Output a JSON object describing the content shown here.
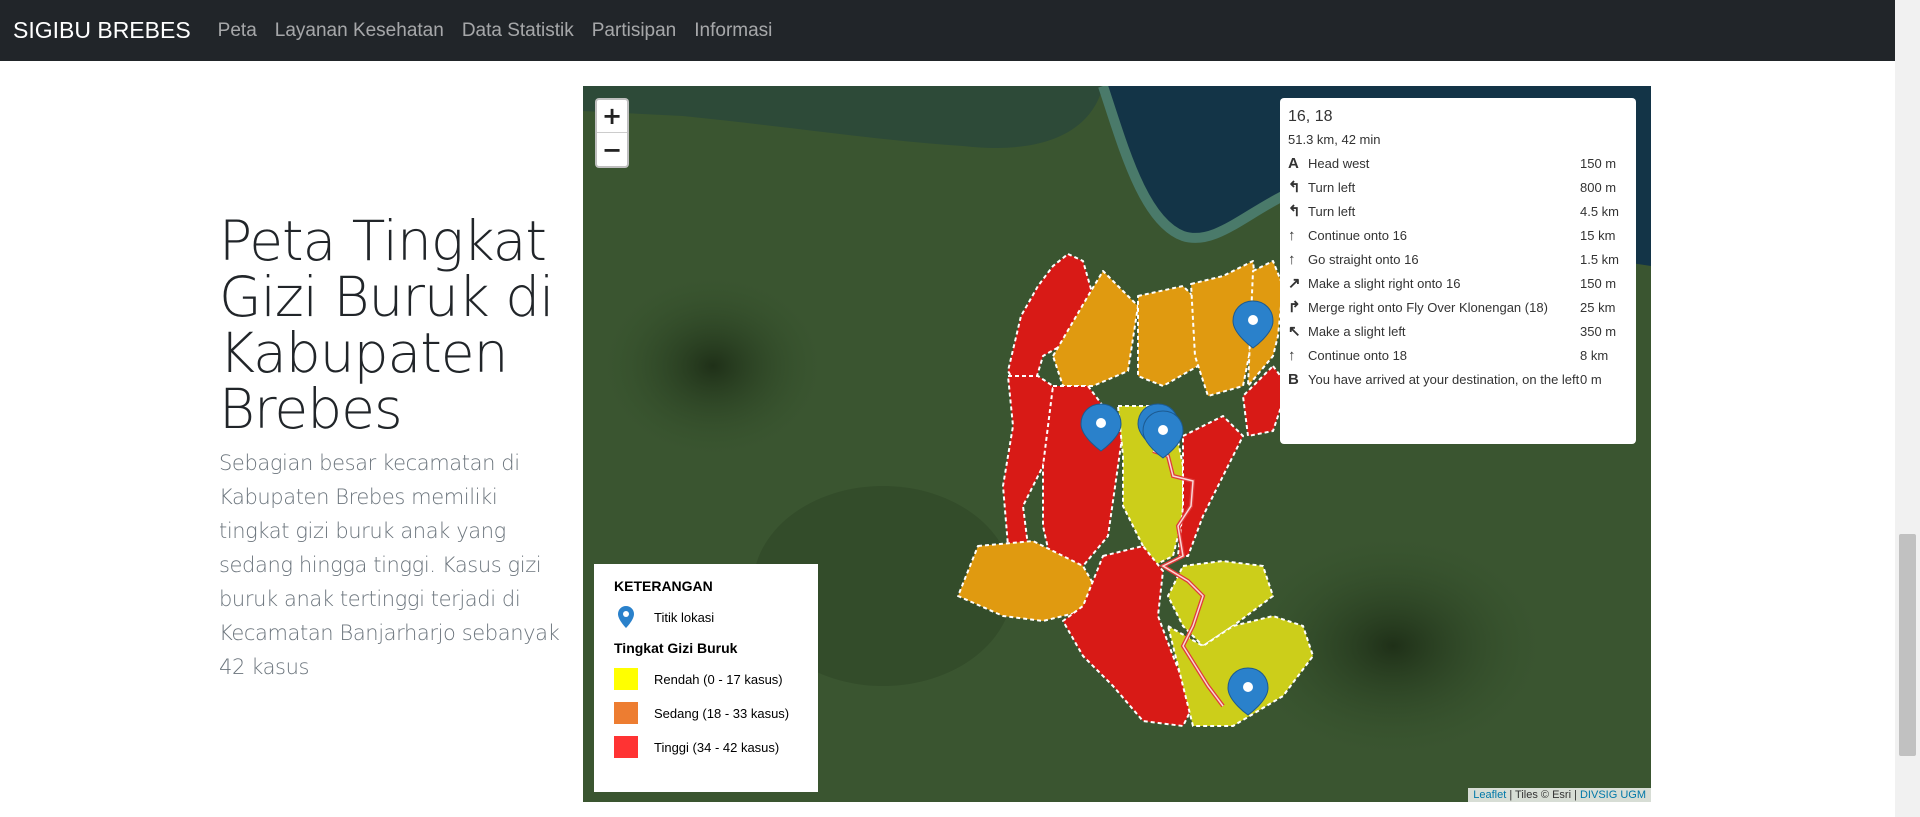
{
  "navbar": {
    "brand": "SIGIBU BREBES",
    "links": [
      "Peta",
      "Layanan Kesehatan",
      "Data Statistik",
      "Partisipan",
      "Informasi"
    ]
  },
  "hero": {
    "title": "Peta Tingkat Gizi Buruk di Kabupaten Brebes",
    "description": "Sebagian besar kecamatan di Kabupaten Brebes memiliki tingkat gizi buruk anak yang sedang hingga tinggi. Kasus gizi buruk anak tertinggi terjadi di Kecamatan Banjarharjo sebanyak 42 kasus"
  },
  "map": {
    "zoom_in": "+",
    "zoom_out": "−",
    "routing": {
      "title": "16, 18",
      "summary": "51.3 km, 42 min",
      "steps": [
        {
          "icon": "A",
          "text": "Head west",
          "dist": "150 m"
        },
        {
          "icon": "↰",
          "text": "Turn left",
          "dist": "800 m"
        },
        {
          "icon": "↰",
          "text": "Turn left",
          "dist": "4.5 km"
        },
        {
          "icon": "↑",
          "text": "Continue onto 16",
          "dist": "15 km"
        },
        {
          "icon": "↑",
          "text": "Go straight onto 16",
          "dist": "1.5 km"
        },
        {
          "icon": "↗",
          "text": "Make a slight right onto 16",
          "dist": "150 m"
        },
        {
          "icon": "↱",
          "text": "Merge right onto Fly Over Klonengan (18)",
          "dist": "25 km"
        },
        {
          "icon": "↖",
          "text": "Make a slight left",
          "dist": "350 m"
        },
        {
          "icon": "↑",
          "text": "Continue onto 18",
          "dist": "8 km"
        },
        {
          "icon": "B",
          "text": "You have arrived at your destination, on the left",
          "dist": "0 m"
        }
      ]
    },
    "legend": {
      "title": "KETERANGAN",
      "location_label": "Titik lokasi",
      "subtitle": "Tingkat Gizi Buruk",
      "classes": [
        {
          "label": "Rendah (0 - 17 kasus)",
          "color": "#ffff00"
        },
        {
          "label": "Sedang (18 - 33 kasus)",
          "color": "#ed7d31"
        },
        {
          "label": "Tinggi (34 - 42 kasus)",
          "color": "#ff3333"
        }
      ]
    },
    "attribution": {
      "leaflet": "Leaflet",
      "tiles": " | Tiles © Esri | ",
      "source": "DIVSIG UGM"
    },
    "colors": {
      "high": "#d81a16",
      "medium": "#e09a10",
      "low": "#ccce1a",
      "marker": "#2a81cb"
    }
  }
}
